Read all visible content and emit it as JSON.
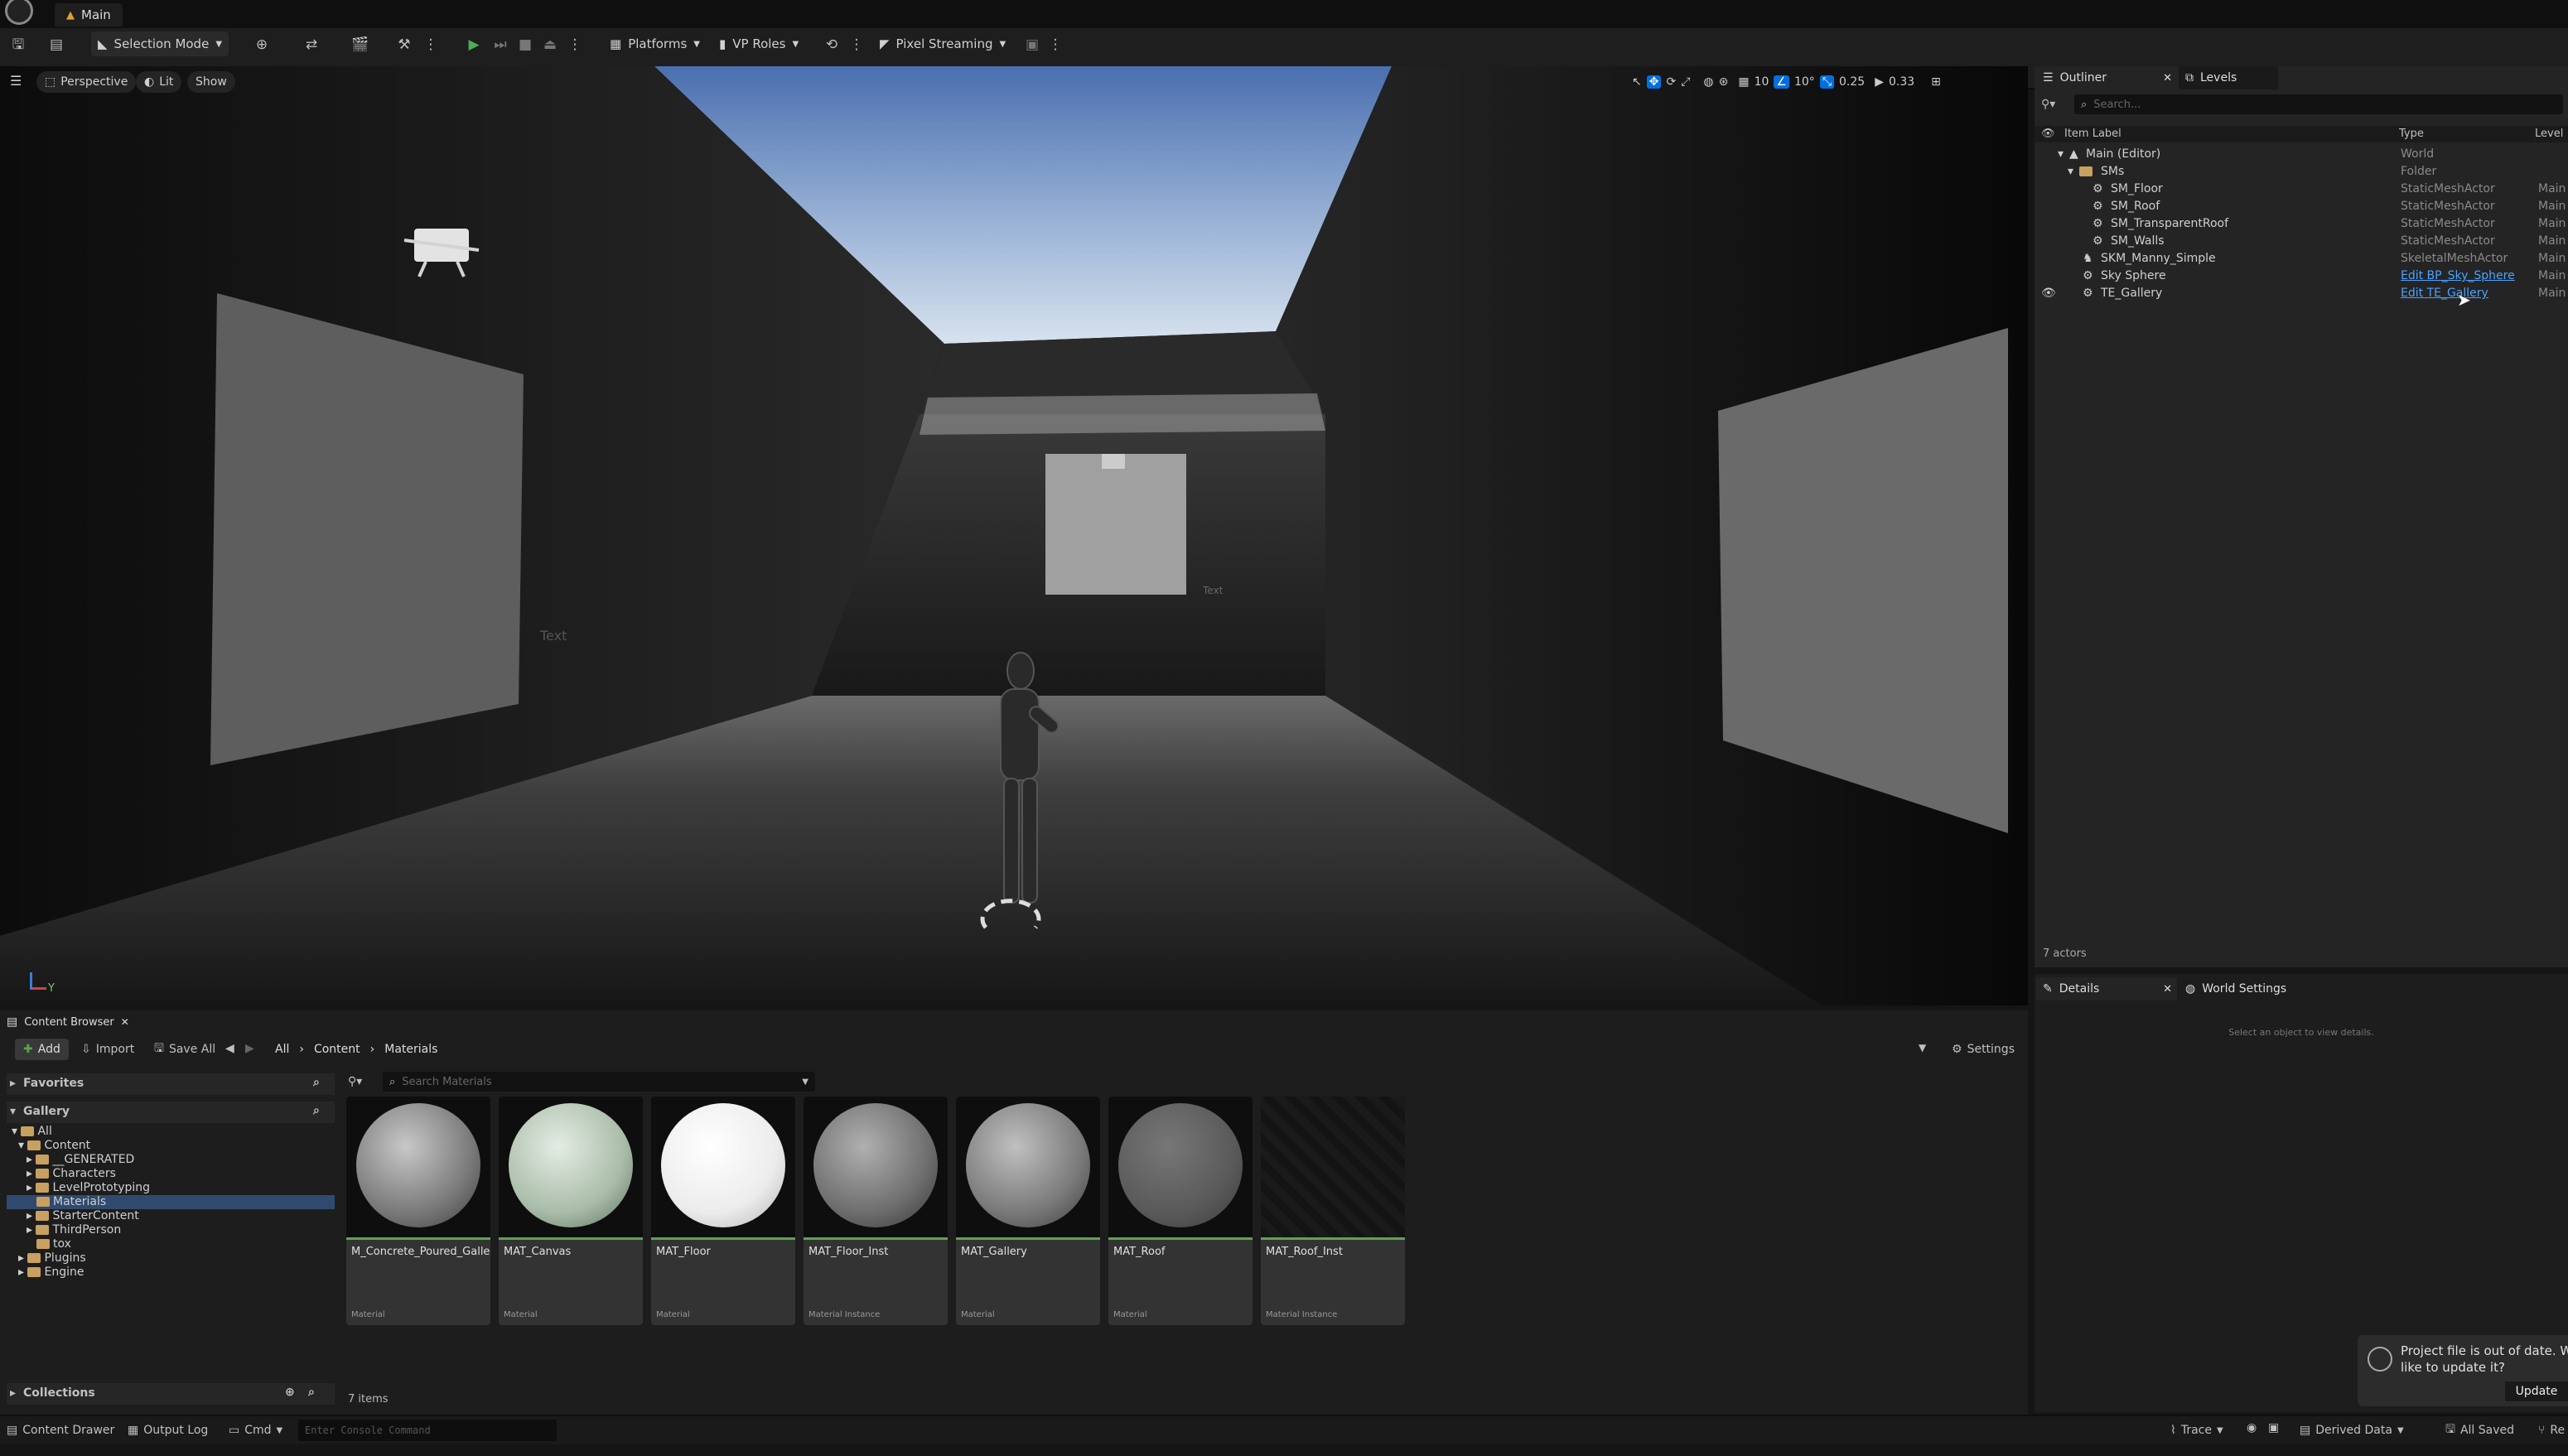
{
  "window": {
    "tab_title": "Main"
  },
  "toolbar": {
    "selection_mode": "Selection Mode",
    "platforms": "Platforms",
    "vp_roles": "VP Roles",
    "pixel_streaming": "Pixel Streaming"
  },
  "viewport": {
    "perspective": "Perspective",
    "lit": "Lit",
    "show": "Show",
    "grid_snap": "10",
    "rot_snap": "10°",
    "scale_snap": "0.25",
    "cam_speed": "0.33",
    "text_left": "Text",
    "text_center": "Text",
    "axis_label": "Y"
  },
  "outliner": {
    "tab": "Outliner",
    "levels_tab": "Levels",
    "search_placeholder": "Search...",
    "col_label": "Item Label",
    "col_type": "Type",
    "col_level": "Level",
    "rows": [
      {
        "label": "Main (Editor)",
        "type": "World",
        "level": ""
      },
      {
        "label": "SMs",
        "type": "Folder",
        "level": ""
      },
      {
        "label": "SM_Floor",
        "type": "StaticMeshActor",
        "level": "Main"
      },
      {
        "label": "SM_Roof",
        "type": "StaticMeshActor",
        "level": "Main"
      },
      {
        "label": "SM_TransparentRoof",
        "type": "StaticMeshActor",
        "level": "Main"
      },
      {
        "label": "SM_Walls",
        "type": "StaticMeshActor",
        "level": "Main"
      },
      {
        "label": "SKM_Manny_Simple",
        "type": "SkeletalMeshActor",
        "level": "Main"
      },
      {
        "label": "Sky Sphere",
        "type": "Edit BP_Sky_Sphere",
        "level": "Main"
      },
      {
        "label": "TE_Gallery",
        "type": "Edit TE_Gallery",
        "level": "Main"
      }
    ],
    "actor_count": "7 actors"
  },
  "details": {
    "tab": "Details",
    "world_tab": "World Settings",
    "empty_msg": "Select an object to view details."
  },
  "content_browser": {
    "tab": "Content Browser",
    "add": "Add",
    "import": "Import",
    "save_all": "Save All",
    "crumbs": [
      "All",
      "Content",
      "Materials"
    ],
    "settings": "Settings",
    "favorites": "Favorites",
    "gallery": "Gallery",
    "search_placeholder": "Search Materials",
    "tree": [
      "All",
      "Content",
      "__GENERATED",
      "Characters",
      "LevelPrototyping",
      "Materials",
      "StarterContent",
      "ThirdPerson",
      "tox",
      "Plugins",
      "Engine"
    ],
    "collections": "Collections",
    "item_count": "7 items",
    "assets": [
      {
        "name": "M_Concrete_Poured_Gallery",
        "type": "Material",
        "color": "#9a9a9a"
      },
      {
        "name": "MAT_Canvas",
        "type": "Material",
        "color": "#b8c8b8"
      },
      {
        "name": "MAT_Floor",
        "type": "Material",
        "color": "#f2f2f2"
      },
      {
        "name": "MAT_Floor_Inst",
        "type": "Material Instance",
        "color": "#8a8a8a"
      },
      {
        "name": "MAT_Gallery",
        "type": "Material",
        "color": "#9a9a9a"
      },
      {
        "name": "MAT_Roof",
        "type": "Material",
        "color": "#666666"
      },
      {
        "name": "MAT_Roof_Inst",
        "type": "Material Instance",
        "color": "#151515"
      }
    ]
  },
  "notification": {
    "text_line1": "Project file is out of date. W",
    "text_line2": "like to update it?",
    "update": "Update"
  },
  "statusbar": {
    "content_drawer": "Content Drawer",
    "output_log": "Output Log",
    "cmd": "Cmd",
    "console_placeholder": "Enter Console Command",
    "trace": "Trace",
    "derived_data": "Derived Data",
    "all_saved": "All Saved",
    "revision": "Re"
  },
  "colors": {
    "accent": "#0070e0",
    "link": "#4aa3ff",
    "green": "#5ea54a"
  }
}
